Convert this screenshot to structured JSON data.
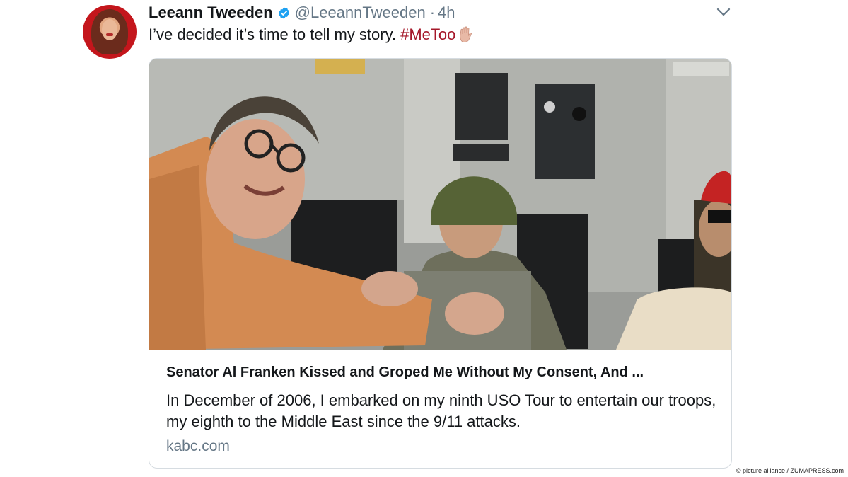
{
  "tweet": {
    "author_name": "Leeann Tweeden",
    "handle": "@LeeannTweeden",
    "separator": "·",
    "time": "4h",
    "text": "I’ve decided it’s time to tell my story.",
    "hashtag": "#MeToo",
    "verified_icon": "verified-badge-icon",
    "menu_icon": "chevron-down-icon",
    "emoji_icon": "raised-hand-emoji-icon"
  },
  "card": {
    "title": "Senator Al Franken Kissed and Groped Me Without My Consent, And ...",
    "description": "In December of 2006, I embarked on my ninth USO Tour to entertain our troops, my eighth to the Middle East since the 9/11 attacks.",
    "domain": "kabc.com"
  },
  "photo_credit": "© picture alliance / ZUMAPRESS.com",
  "colors": {
    "hashtag": "#a5182a",
    "secondary_text": "#657786",
    "verified": "#1da1f2"
  }
}
